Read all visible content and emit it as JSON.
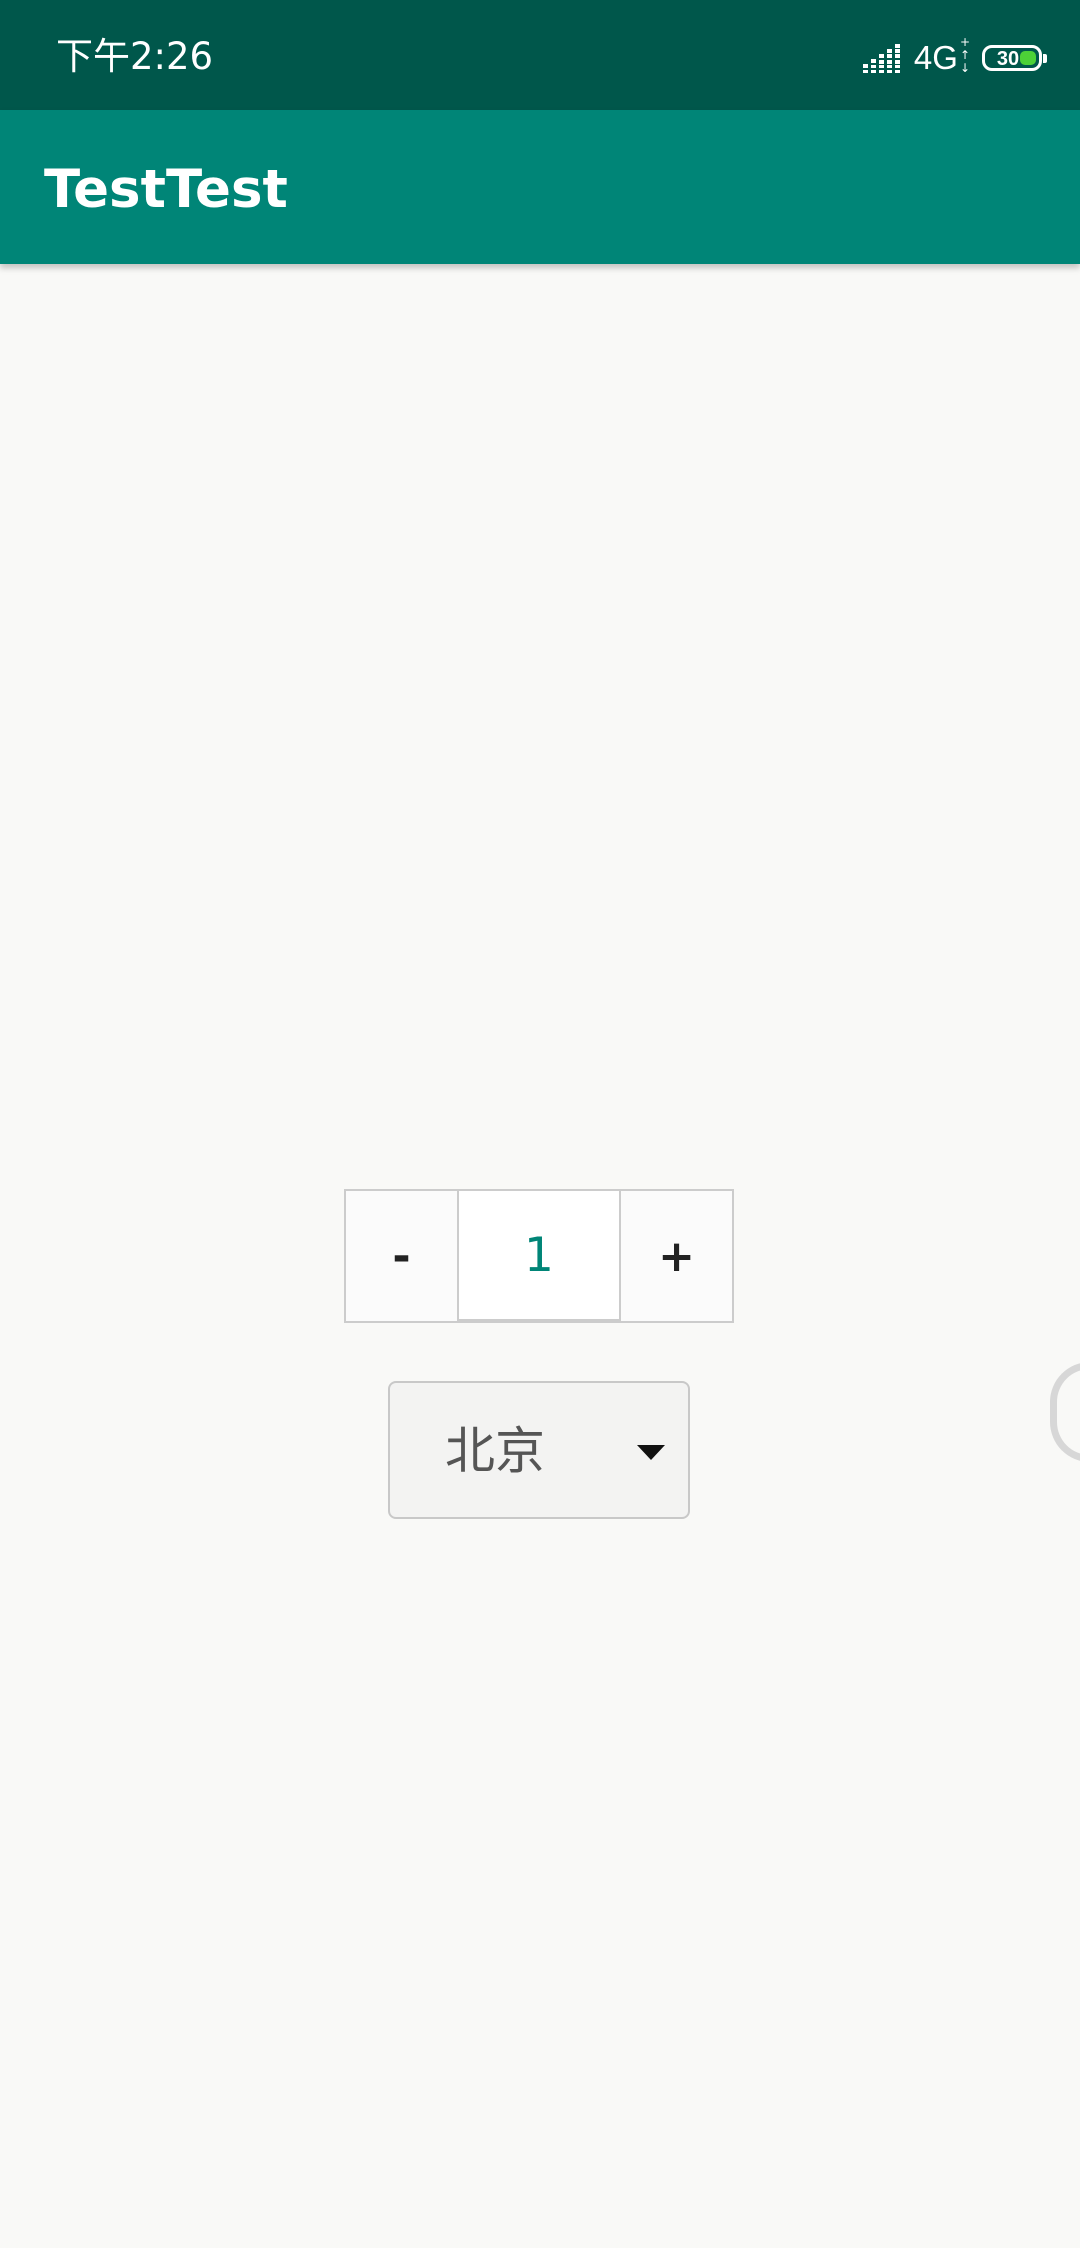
{
  "status_bar": {
    "time": "下午2:26",
    "network": "4G",
    "network_plus": "+",
    "data_arrows_up": "↑",
    "data_arrows_down": "↓",
    "battery_level": "30",
    "battery_color": "#4cd137",
    "background": "#00574b"
  },
  "app_bar": {
    "title": "TestTest",
    "background": "#008577"
  },
  "stepper": {
    "minus_label": "-",
    "value": "1",
    "plus_label": "+",
    "value_color": "#008577"
  },
  "city_select": {
    "selected": "北京",
    "icon": "dropdown-triangle-icon"
  },
  "edge_handle": {
    "icon": "edge-gesture-handle"
  }
}
